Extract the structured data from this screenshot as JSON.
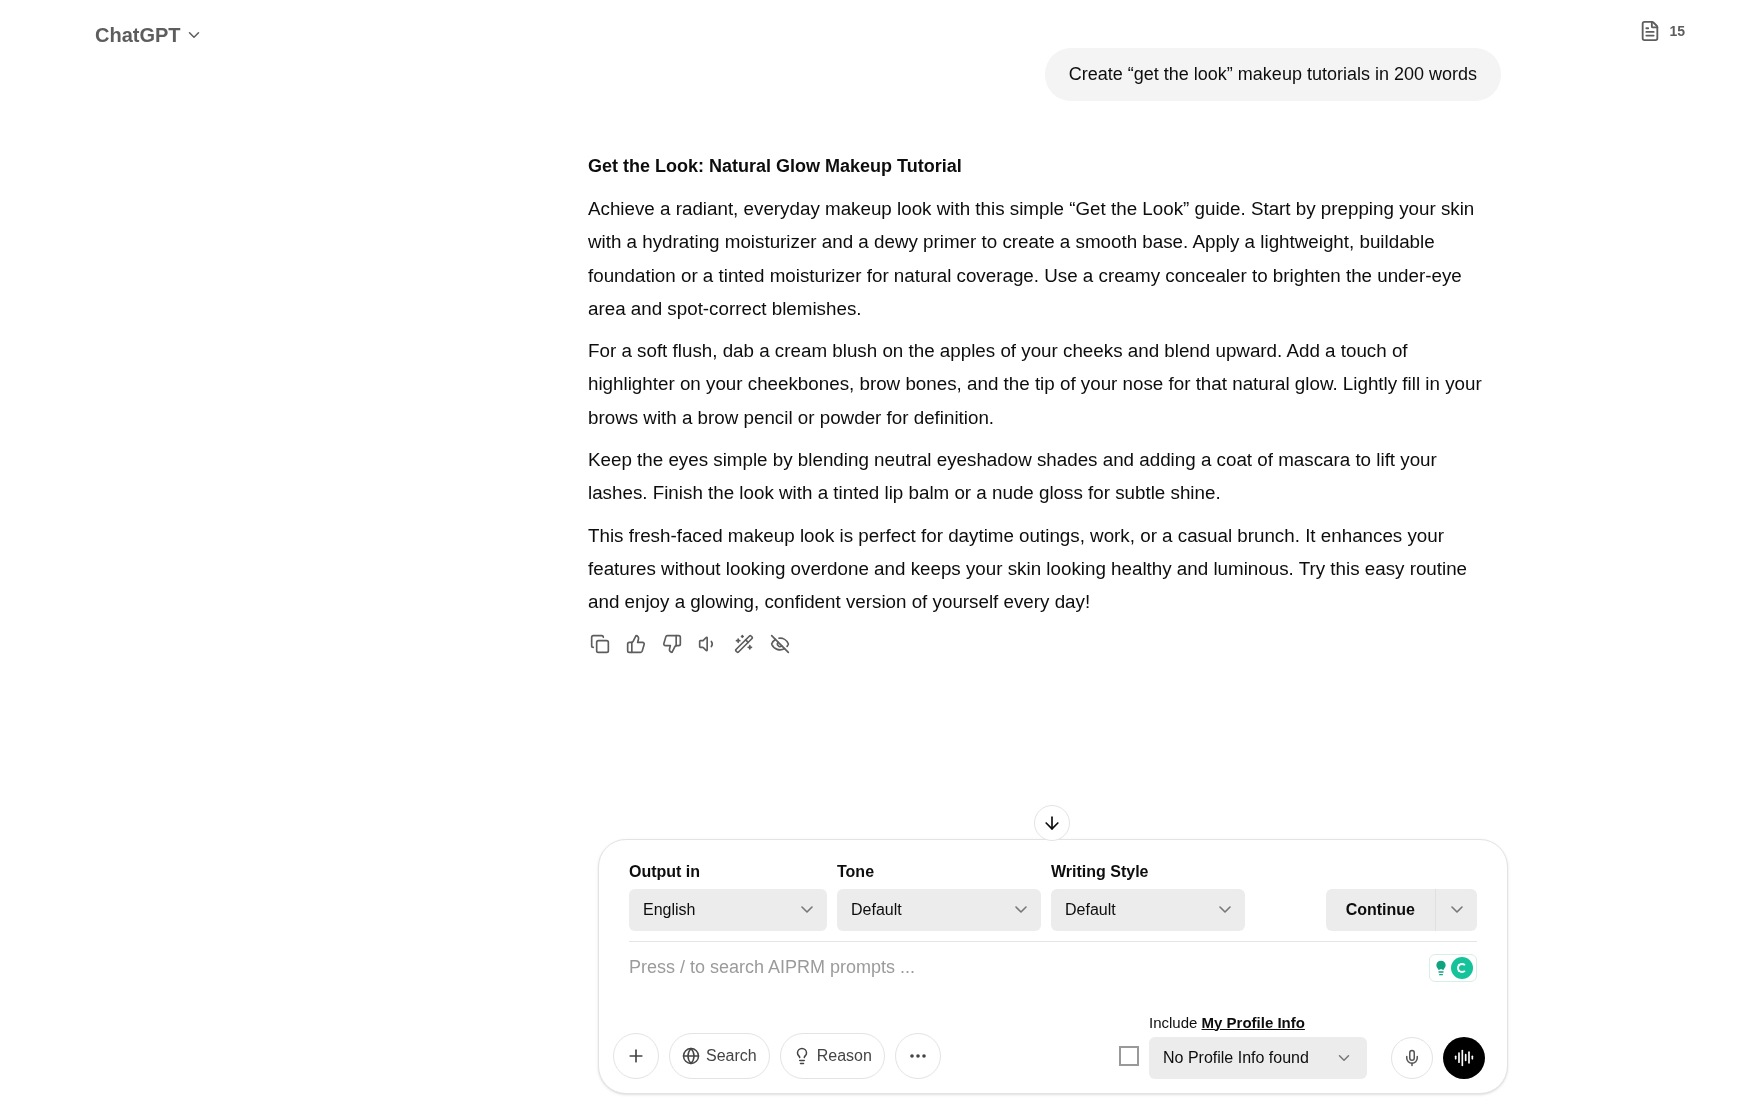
{
  "header": {
    "title": "ChatGPT",
    "doc_count": "15"
  },
  "user_message": "Create “get the look” makeup tutorials in 200 words",
  "response": {
    "heading": "Get the Look: Natural Glow Makeup Tutorial",
    "paragraphs": [
      "Achieve a radiant, everyday makeup look with this simple “Get the Look” guide. Start by prepping your skin with a hydrating moisturizer and a dewy primer to create a smooth base. Apply a lightweight, buildable foundation or a tinted moisturizer for natural coverage. Use a creamy concealer to brighten the under-eye area and spot-correct blemishes.",
      "For a soft flush, dab a cream blush on the apples of your cheeks and blend upward. Add a touch of highlighter on your cheekbones, brow bones, and the tip of your nose for that natural glow. Lightly fill in your brows with a brow pencil or powder for definition.",
      "Keep the eyes simple by blending neutral eyeshadow shades and adding a coat of mascara to lift your lashes. Finish the look with a tinted lip balm or a nude gloss for subtle shine.",
      "This fresh-faced makeup look is perfect for daytime outings, work, or a casual brunch. It enhances your features without looking overdone and keeps your skin looking healthy and luminous. Try this easy routine and enjoy a glowing, confident version of yourself every day!"
    ]
  },
  "composer": {
    "selects": [
      {
        "label": "Output in",
        "value": "English"
      },
      {
        "label": "Tone",
        "value": "Default"
      },
      {
        "label": "Writing Style",
        "value": "Default"
      }
    ],
    "continue_button": "Continue",
    "prompt_placeholder": "Press / to search AIPRM prompts ...",
    "tools": [
      {
        "kind": "plus"
      },
      {
        "kind": "search",
        "label": "Search"
      },
      {
        "kind": "reason",
        "label": "Reason"
      },
      {
        "kind": "more"
      }
    ],
    "profile": {
      "prefix": "Include",
      "link": "My Profile Info",
      "checked": false,
      "value": "No Profile Info found"
    }
  }
}
